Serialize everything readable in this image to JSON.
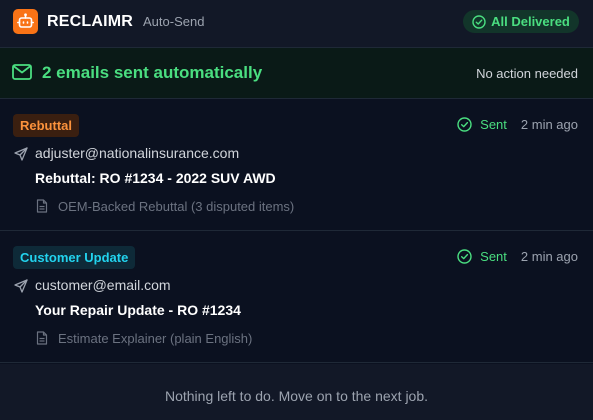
{
  "header": {
    "app_name": "RECLAIMR",
    "mode": "Auto-Send",
    "status_badge": "All Delivered",
    "logo_icon": "robot-icon"
  },
  "banner": {
    "title": "2 emails sent automatically",
    "note": "No action needed",
    "icon": "mail-icon"
  },
  "emails": [
    {
      "tag": "Rebuttal",
      "tag_color": "#fb923c",
      "status": "Sent",
      "time": "2 min ago",
      "recipient": "adjuster@nationalinsurance.com",
      "subject": "Rebuttal: RO #1234 - 2022 SUV AWD",
      "attachment": "OEM-Backed Rebuttal (3 disputed items)"
    },
    {
      "tag": "Customer Update",
      "tag_color": "#22d3ee",
      "status": "Sent",
      "time": "2 min ago",
      "recipient": "customer@email.com",
      "subject": "Your Repair Update - RO #1234",
      "attachment": "Estimate Explainer (plain English)"
    }
  ],
  "footer": {
    "message": "Nothing left to do. Move on to the next job."
  },
  "colors": {
    "accent": "#f97316",
    "success": "#4ade80",
    "background": "#0b1120"
  }
}
